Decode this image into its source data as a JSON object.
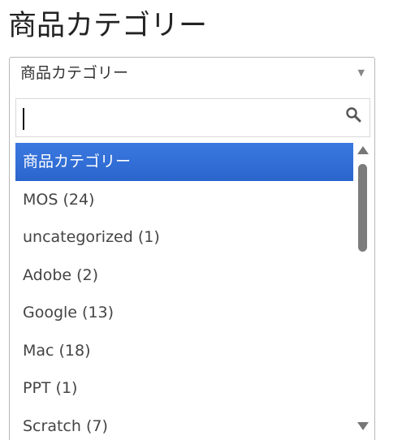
{
  "heading": "商品カテゴリー",
  "select": {
    "value": "商品カテゴリー",
    "arrow": "▼"
  },
  "search": {
    "value": "",
    "icon": "search-icon"
  },
  "options": [
    {
      "label": "商品カテゴリー",
      "selected": true
    },
    {
      "label": "MOS (24)"
    },
    {
      "label": "uncategorized (1)"
    },
    {
      "label": "Adobe (2)"
    },
    {
      "label": "Google (13)"
    },
    {
      "label": "Mac (18)"
    },
    {
      "label": "PPT (1)"
    },
    {
      "label": "Scratch (7)"
    }
  ],
  "colors": {
    "selected_bg": "#2f6fd6",
    "border": "#b8b8b8",
    "scrollbar": "#7c7c7c"
  }
}
